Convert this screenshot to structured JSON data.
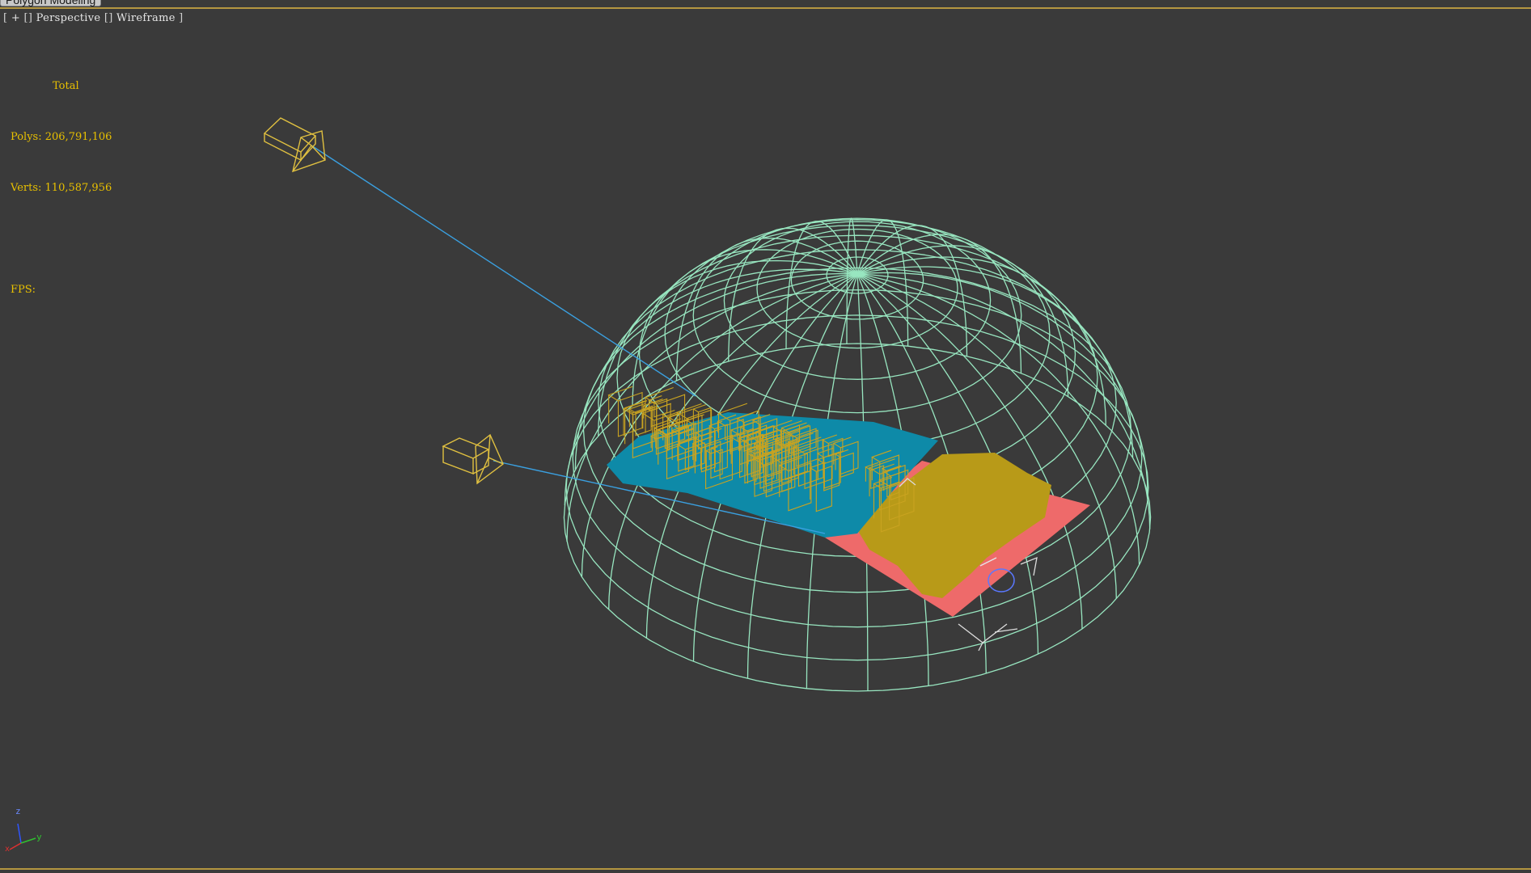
{
  "ribbon": {
    "tab_label": "Polygon Modeling"
  },
  "viewport": {
    "label_open": "[",
    "plus": "+",
    "box1": "[]",
    "view_name": "Perspective",
    "box2": "[]",
    "shading": "Wireframe",
    "label_close": "]"
  },
  "stats": {
    "header": "Total",
    "polys_label": "Polys:",
    "polys_value": "206,791,106",
    "verts_label": "Verts:",
    "verts_value": "110,587,956",
    "fps_label": "FPS:"
  },
  "axis": {
    "z": "z",
    "y": "y",
    "x": "x"
  },
  "colors": {
    "background": "#3a3a3a",
    "border_accent": "#b49640",
    "stats_text": "#e8c000",
    "dome_wire": "#98e6c0",
    "camera": "#e0c040",
    "target_line": "#3aa0e0",
    "teal_mesh": "#0e8aa8",
    "gold_mesh": "#b89a18",
    "pink_ground": "#ee6a6a"
  },
  "icons": [
    "camera-icon",
    "camera-icon",
    "axis-tripod-icon",
    "transform-gizmo-icon"
  ]
}
